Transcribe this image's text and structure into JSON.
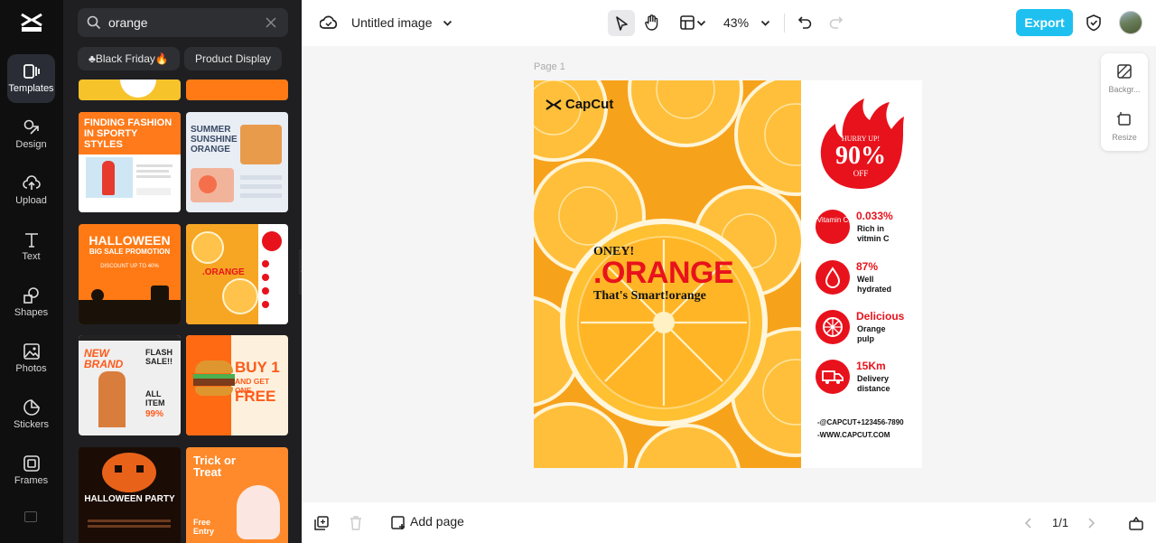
{
  "rail": {
    "items": [
      {
        "label": "Templates",
        "icon": "templates-icon",
        "active": true
      },
      {
        "label": "Design",
        "icon": "design-icon"
      },
      {
        "label": "Upload",
        "icon": "upload-icon"
      },
      {
        "label": "Text",
        "icon": "text-icon"
      },
      {
        "label": "Shapes",
        "icon": "shapes-icon"
      },
      {
        "label": "Photos",
        "icon": "photos-icon"
      },
      {
        "label": "Stickers",
        "icon": "stickers-icon"
      },
      {
        "label": "Frames",
        "icon": "frames-icon"
      }
    ]
  },
  "panel": {
    "search_value": "orange",
    "chips": [
      "♣Black Friday🔥",
      "Product Display"
    ],
    "thumbs": {
      "t1_title": "FINDING FASHION IN SPORTY STYLES",
      "t2_title": "SUMMER SUNSHINE ORANGE",
      "t3_title": "HALLOWEEN",
      "t3_sub": "BIG SALE PROMOTION",
      "t3_discount": "DISCOUNT UP TO 40%",
      "t4_title": ".ORANGE",
      "t5_title": "NEW BRAND",
      "t5_side": "FLASH SALE!!",
      "t5_all": "ALL ITEM",
      "t5_pct": "99%",
      "t6_title": "BUY 1",
      "t6_sub": "AND GET ONE",
      "t6_free": "FREE",
      "t7_title": "HALLOWEEN PARTY",
      "t8_title": "Trick or Treat",
      "t8_free": "Free Entry"
    }
  },
  "topbar": {
    "doc_title": "Untitled image",
    "zoom": "43%",
    "export_label": "Export"
  },
  "canvas": {
    "page_label": "Page 1",
    "side_tools": [
      "Backgr...",
      "Resize"
    ]
  },
  "design": {
    "brand": "CapCut",
    "hurry": "HURRY UP!",
    "discount": "90%",
    "off": "OFF",
    "headline_pre": "ONEY!",
    "headline": ".ORANGE",
    "tagline": "That's Smart!orange",
    "features": [
      {
        "badge": "Vitamin C",
        "value": "0.033%",
        "desc1": "Rich in",
        "desc2": "vitmin C"
      },
      {
        "value": "87%",
        "desc1": "Well",
        "desc2": "hydrated"
      },
      {
        "value": "Delicious",
        "desc1": "Orange",
        "desc2": "pulp"
      },
      {
        "value": "15Km",
        "desc1": "Delivery",
        "desc2": "distance"
      }
    ],
    "contact1": "-@CAPCUT+123456-7890",
    "contact2": "-WWW.CAPCUT.COM",
    "accent": "#e8121c",
    "orange": "#f7a21b"
  },
  "bottombar": {
    "add_page_label": "Add page",
    "pager": "1/1"
  }
}
